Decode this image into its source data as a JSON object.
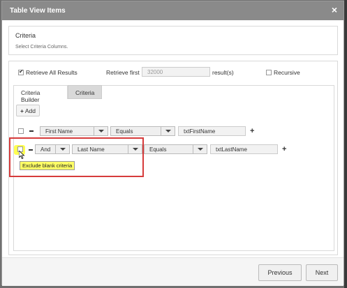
{
  "dialog": {
    "title": "Table View Items",
    "close_glyph": "×"
  },
  "criteria": {
    "title": "Criteria",
    "subtitle": "Select Criteria Columns."
  },
  "options": {
    "retrieve_all_label": "Retrieve All Results",
    "retrieve_all_checked": true,
    "retrieve_first_label": "Retrieve first",
    "retrieve_first_placeholder": "32000",
    "results_label": "result(s)",
    "recursive_label": "Recursive",
    "recursive_checked": false
  },
  "tabs": [
    {
      "label": "Criteria Builder",
      "active": true
    },
    {
      "label": "Criteria",
      "active": false
    }
  ],
  "add_button": {
    "icon": "+",
    "label": "Add"
  },
  "rows": [
    {
      "field": "First Name",
      "operator": "Equals",
      "value": "txtFirstName"
    },
    {
      "conjunction": "And",
      "field": "Last Name",
      "operator": "Equals",
      "value": "txtLastName"
    }
  ],
  "tooltip": "Exclude blank criteria",
  "footer": {
    "previous_label": "Previous",
    "next_label": "Next"
  },
  "colors": {
    "titlebar": "#8a8a8a",
    "highlight_box": "#d63b3b",
    "tooltip_bg": "#ffff66"
  }
}
